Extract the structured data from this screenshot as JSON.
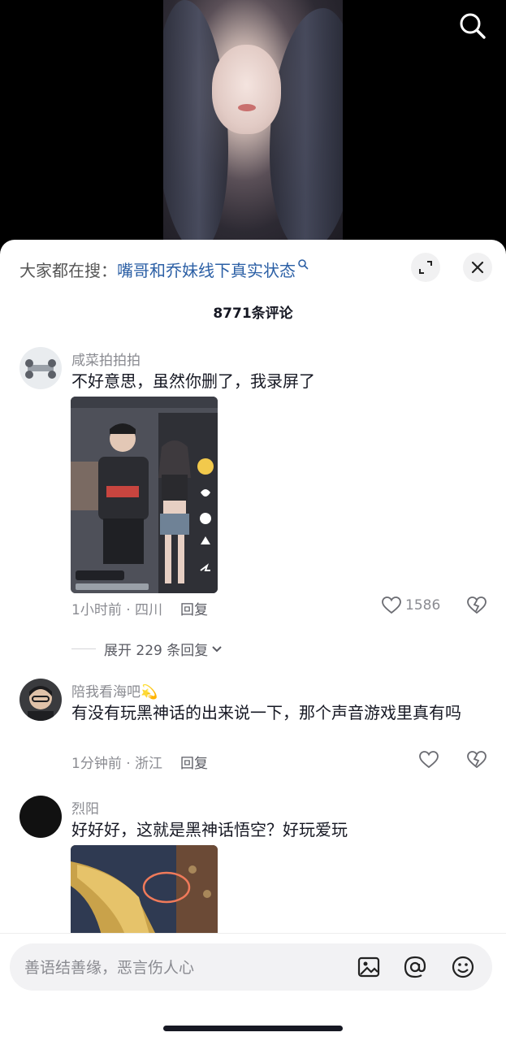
{
  "search_suggestion": {
    "prefix": "大家都在搜：",
    "query": "嘴哥和乔妹线下真实状态"
  },
  "comments_title": "8771条评论",
  "comments": [
    {
      "username": "咸菜拍拍拍",
      "text": "不好意思，虽然你删了，我录屏了",
      "time_location": "1小时前 · 四川",
      "reply_label": "回复",
      "likes": "1586",
      "expand_label": "展开 229 条回复"
    },
    {
      "username": "陪我看海吧💫",
      "text": "有没有玩黑神话的出来说一下，那个声音游戏里真有吗",
      "time_location": "1分钟前 · 浙江",
      "reply_label": "回复"
    },
    {
      "username": "烈阳",
      "text": "好好好，这就是黑神话悟空？好玩爱玩"
    }
  ],
  "input": {
    "placeholder": "善语结善缘，恶言伤人心"
  },
  "icons": [
    "search-icon",
    "fullscreen-icon",
    "close-icon",
    "heart-icon",
    "dislike-icon",
    "chevron-down-icon",
    "image-icon",
    "at-icon",
    "emoji-icon"
  ],
  "colors": {
    "link": "#2b5fa5",
    "muted": "#8a8b91",
    "text": "#161823"
  }
}
